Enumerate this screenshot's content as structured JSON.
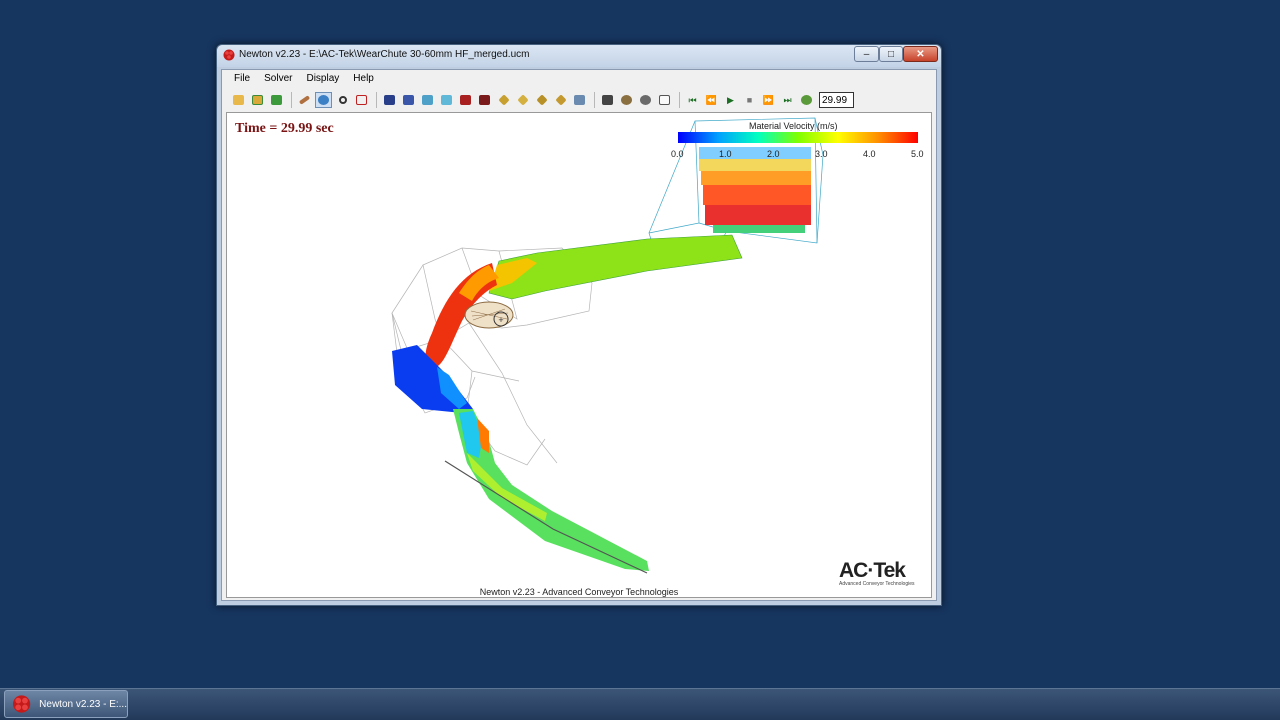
{
  "window": {
    "title": "Newton v2.23 - E:\\AC-Tek\\WearChute 30-60mm HF_merged.ucm",
    "min_label": "‒",
    "max_label": "□",
    "close_label": "✕"
  },
  "menu": [
    {
      "label": "File"
    },
    {
      "label": "Solver"
    },
    {
      "label": "Display"
    },
    {
      "label": "Help"
    }
  ],
  "toolbar": {
    "time_value": "29.99",
    "icons": [
      "open-folder-icon",
      "open-recent-icon",
      "save-icon",
      "edit-icon",
      "rotate-icon",
      "zoom-icon",
      "select-box-icon",
      "view-front-icon",
      "view-back-icon",
      "view-left-icon",
      "view-right-icon",
      "view-top-icon",
      "view-bottom-icon",
      "iso-view-1-icon",
      "iso-view-2-icon",
      "iso-view-3-icon",
      "iso-view-4-icon",
      "projection-icon",
      "camera-icon",
      "settings-icon",
      "particles-icon",
      "graph-icon",
      "skip-to-start-icon",
      "step-back-icon",
      "play-icon",
      "stop-icon",
      "step-forward-icon",
      "skip-to-end-icon",
      "speed-icon"
    ]
  },
  "viewport": {
    "time_label": "Time = 29.99 sec",
    "footer": "Newton v2.23 - Advanced Conveyor Technologies",
    "legend": {
      "title": "Material Velocity (m/s)",
      "ticks": [
        "0.0",
        "1.0",
        "2.0",
        "3.0",
        "4.0",
        "5.0"
      ],
      "min": 0.0,
      "max": 5.0
    },
    "logo": {
      "name": "AC·Tek",
      "tagline": "Advanced Conveyor Technologies"
    }
  },
  "taskbar": {
    "app_label": "Newton v2.23 - E:..."
  },
  "colors": {
    "desktop": "#16355f",
    "time_label": "#7a1414",
    "particle_fast": "#ff0000",
    "particle_slow": "#0000ff",
    "particle_mid": "#80ff00"
  }
}
